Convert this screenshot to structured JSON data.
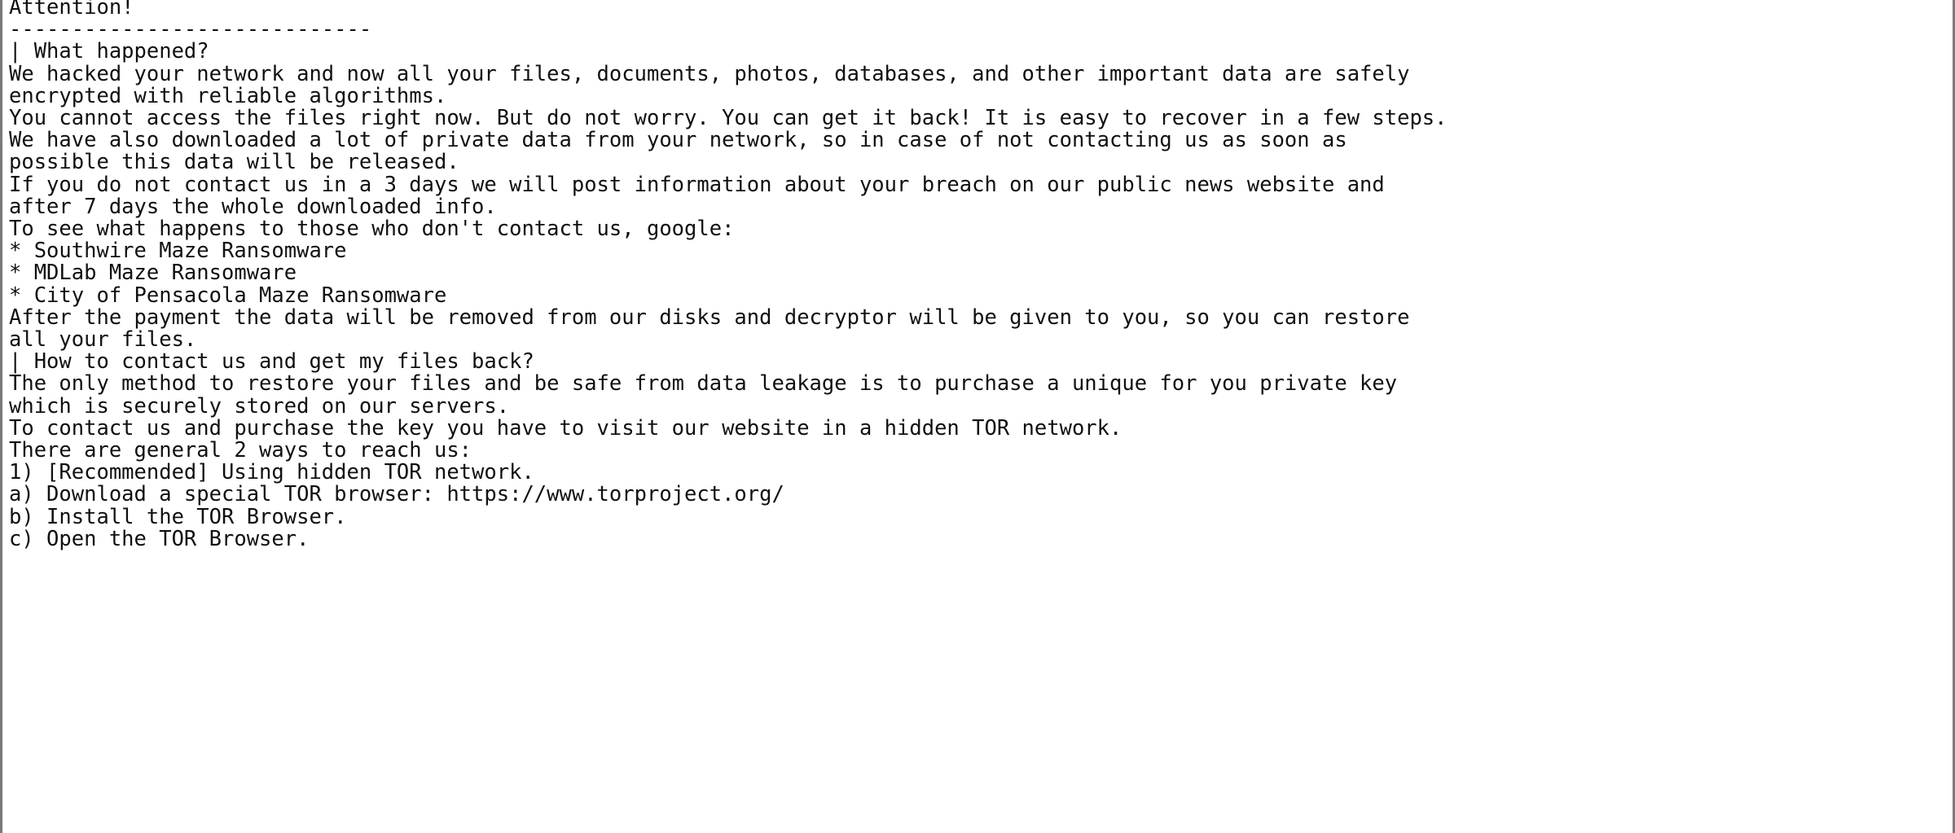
{
  "document": {
    "kind": "ransom-note-text",
    "title": "Attention!",
    "separator": "-----------------------------",
    "background_color": "#ffffff",
    "text_color": "#101014",
    "border_color": "#7a7a7a",
    "lines": [
      "Attention!",
      "-----------------------------",
      "| What happened?",
      "We hacked your network and now all your files, documents, photos, databases, and other important data are safely",
      "encrypted with reliable algorithms.",
      "You cannot access the files right now. But do not worry. You can get it back! It is easy to recover in a few steps.",
      "We have also downloaded a lot of private data from your network, so in case of not contacting us as soon as",
      "possible this data will be released.",
      "If you do not contact us in a 3 days we will post information about your breach on our public news website and",
      "after 7 days the whole downloaded info.",
      "To see what happens to those who don't contact us, google:",
      "* Southwire Maze Ransomware",
      "* MDLab Maze Ransomware",
      "* City of Pensacola Maze Ransomware",
      "After the payment the data will be removed from our disks and decryptor will be given to you, so you can restore",
      "all your files.",
      "| How to contact us and get my files back?",
      "The only method to restore your files and be safe from data leakage is to purchase a unique for you private key",
      "which is securely stored on our servers.",
      "To contact us and purchase the key you have to visit our website in a hidden TOR network.",
      "There are general 2 ways to reach us:",
      "1) [Recommended] Using hidden TOR network.",
      "a) Download a special TOR browser: https://www.torproject.org/",
      "b) Install the TOR Browser.",
      "c) Open the TOR Browser."
    ],
    "mentioned_items": {
      "tor_browser_url": "https://www.torproject.org/",
      "days_to_contact": "3",
      "days_until_full_leak": "7",
      "ways_to_reach": "2",
      "google_examples": [
        "* Southwire Maze Ransomware",
        "* MDLab Maze Ransomware",
        "* City of Pensacola Maze Ransomware"
      ],
      "sections": [
        "| What happened?",
        "| How to contact us and get my files back?"
      ],
      "steps": [
        "1) [Recommended] Using hidden TOR network.",
        "a) Download a special TOR browser: https://www.torproject.org/",
        "b) Install the TOR Browser.",
        "c) Open the TOR Browser."
      ]
    }
  }
}
